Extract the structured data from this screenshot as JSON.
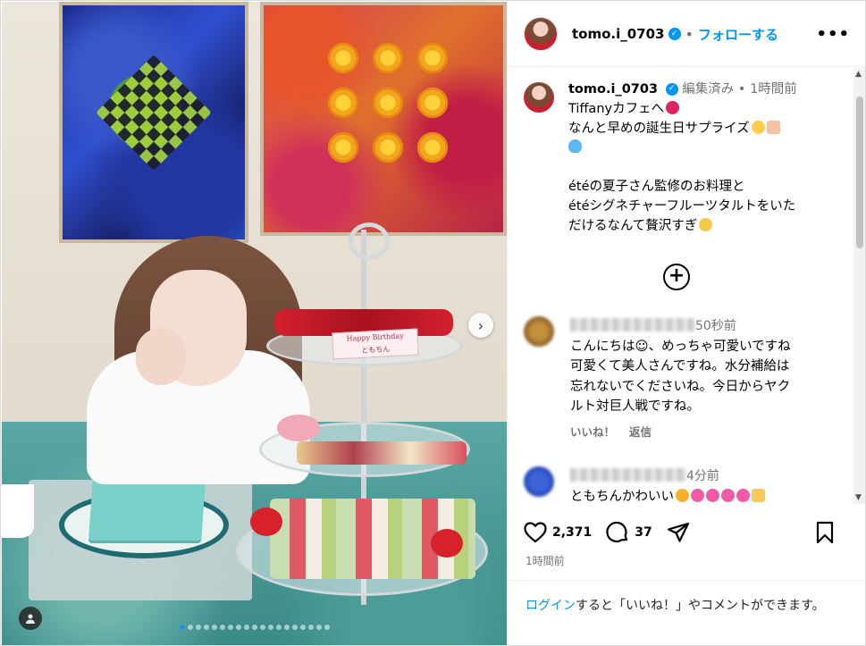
{
  "header": {
    "username": "tomo.i_0703",
    "separator": "•",
    "follow_label": "フォローする",
    "more_label": "•••"
  },
  "caption": {
    "username": "tomo.i_0703",
    "edited": "編集済み",
    "dot": "•",
    "time": "1時間前",
    "lines": [
      "Tiffanyカフェへ",
      "なんと早めの誕生日サプライズ",
      "",
      "",
      "étéの夏子さん監修のお料理と",
      "étéシグネチャーフルーツタルトをいた",
      "だけるなんて贅沢すぎ"
    ],
    "load_more_label": "+"
  },
  "comments": [
    {
      "time": "50秒前",
      "lines": [
        "こんにちは☺︎、めっちゃ可愛いですね",
        "可愛くて美人さんですね。水分補給は",
        "忘れないでくださいね。今日からヤク",
        "ルト対巨人戦ですね。"
      ],
      "like_label": "いいね！",
      "reply_label": "返信"
    },
    {
      "time": "4分前",
      "lines": [
        "ともちんかわいい"
      ]
    }
  ],
  "actions": {
    "likes": "2,371",
    "comments": "37"
  },
  "post_time": "1時間前",
  "login_prompt": {
    "link": "ログイン",
    "text": "すると「いいね！」やコメントができます。"
  },
  "media": {
    "card_text_1": "Happy Birthday",
    "card_text_2": "ともちん",
    "slide_count": 19,
    "active_slide": 1,
    "next_label": "›"
  },
  "colors": {
    "accent": "#0095f6",
    "active_dot": "#1f8ef1"
  }
}
